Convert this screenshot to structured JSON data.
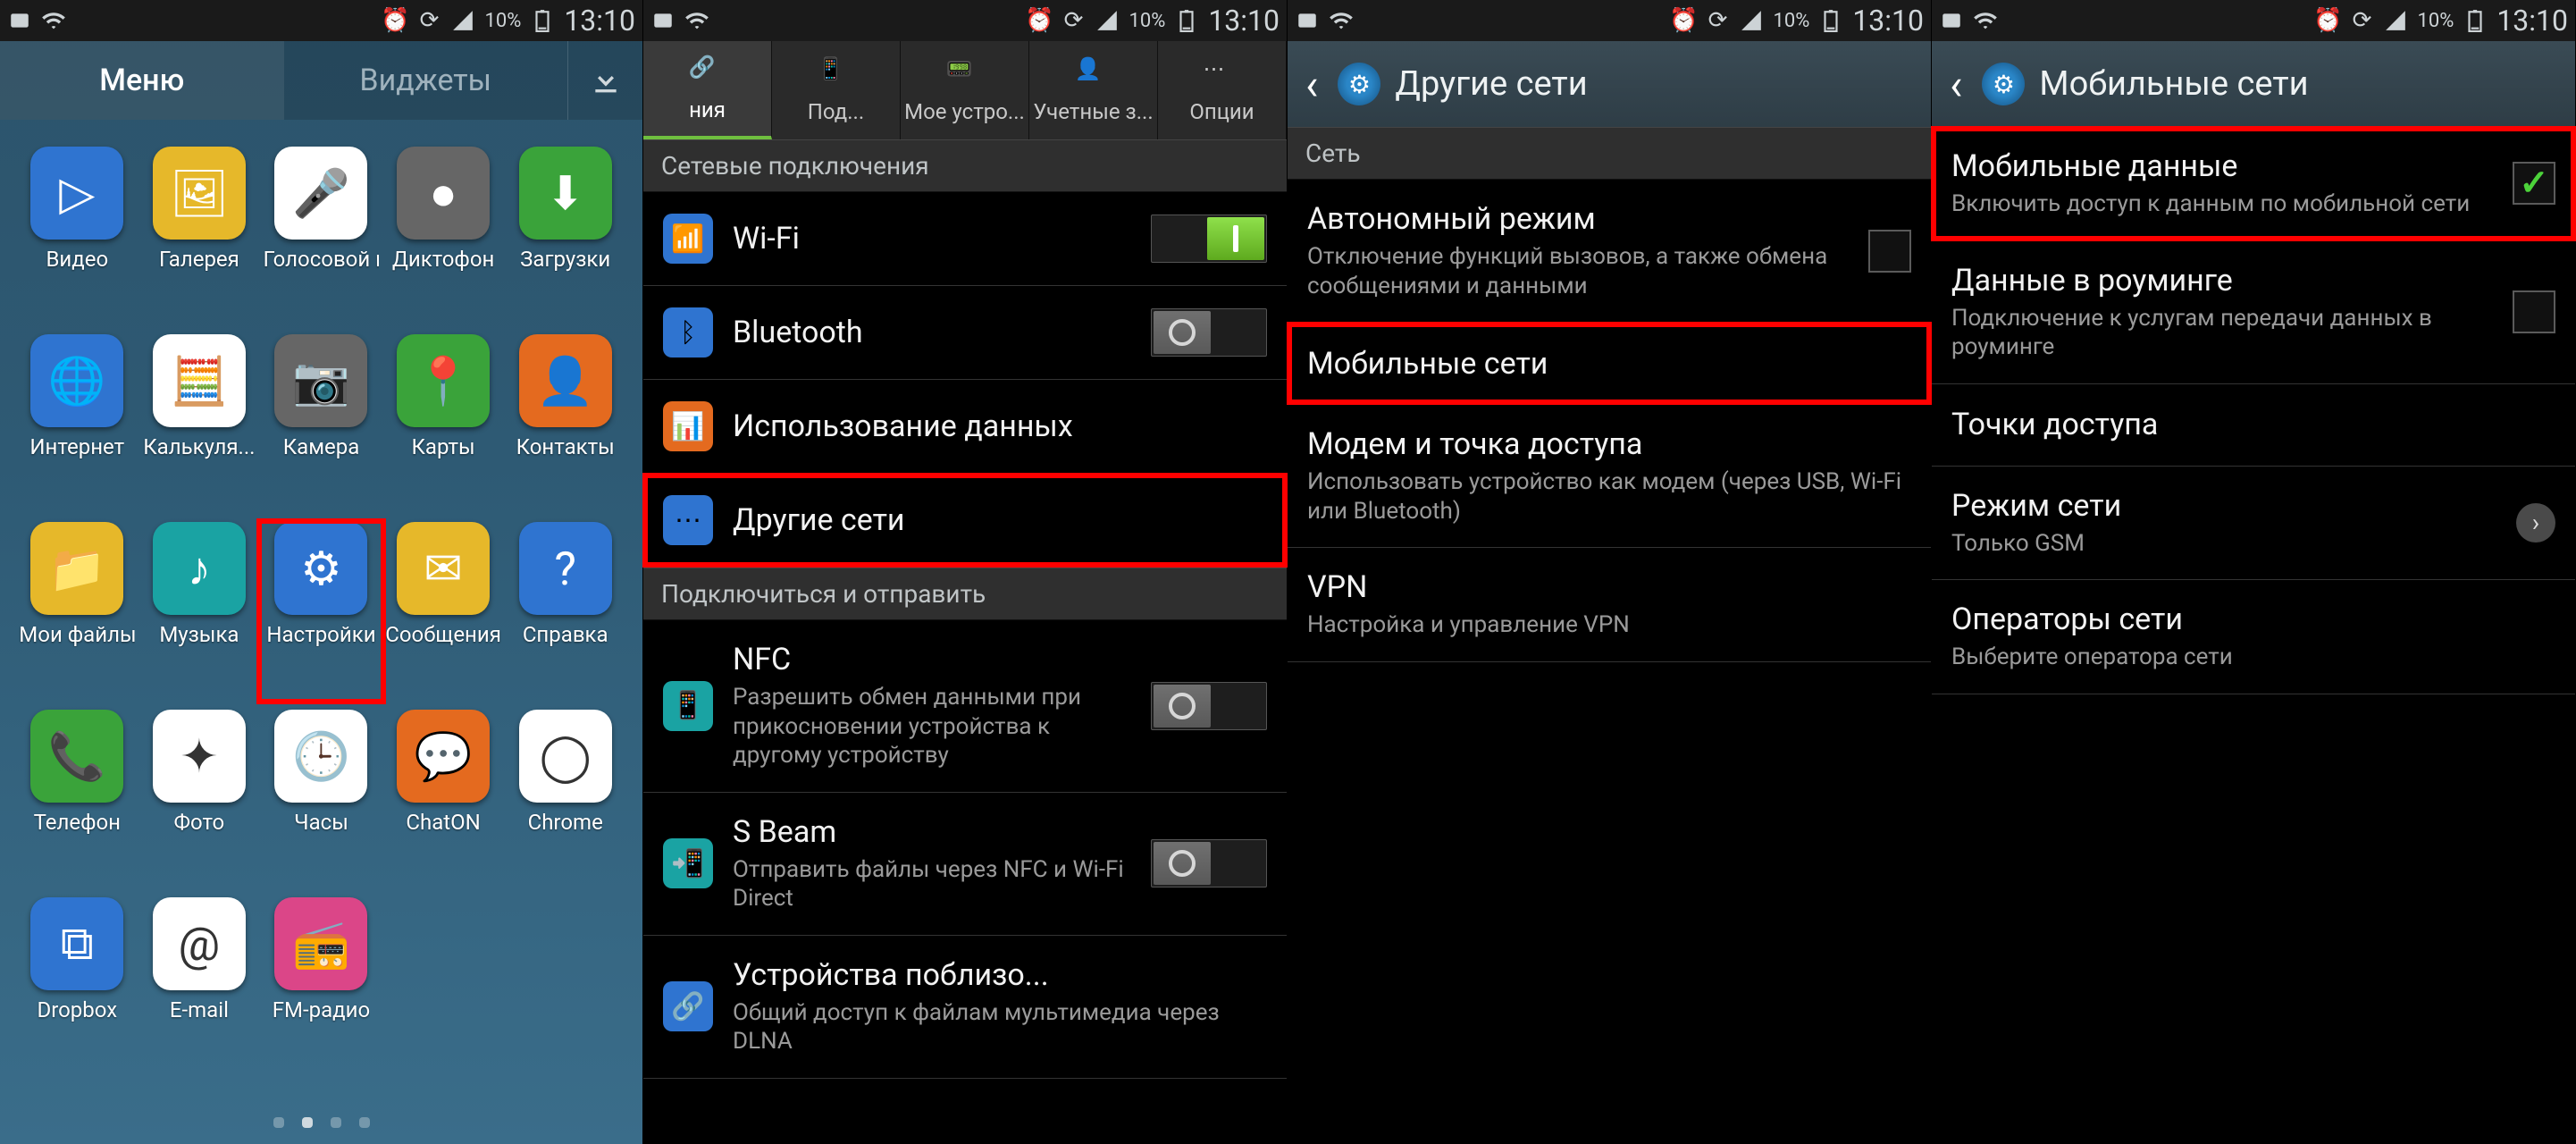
{
  "status": {
    "time": "13:10",
    "battery": "10%",
    "signal": "signal-icon",
    "wifi": "wifi-icon",
    "alarm": "alarm-icon"
  },
  "panel1": {
    "tabs": {
      "menu": "Меню",
      "widgets": "Виджеты"
    },
    "apps": [
      {
        "label": "Видео",
        "icon": "▷",
        "bg": "ic-blue"
      },
      {
        "label": "Галерея",
        "icon": "🖼",
        "bg": "ic-yellow"
      },
      {
        "label": "Голосовой поиск",
        "icon": "🎤",
        "bg": "ic-white"
      },
      {
        "label": "Диктофон",
        "icon": "●",
        "bg": "ic-grey"
      },
      {
        "label": "Загрузки",
        "icon": "⬇",
        "bg": "ic-green"
      },
      {
        "label": "Интернет",
        "icon": "🌐",
        "bg": "ic-blue"
      },
      {
        "label": "Калькуля...",
        "icon": "🧮",
        "bg": "ic-white"
      },
      {
        "label": "Камера",
        "icon": "📷",
        "bg": "ic-grey"
      },
      {
        "label": "Карты",
        "icon": "📍",
        "bg": "ic-green"
      },
      {
        "label": "Контакты",
        "icon": "👤",
        "bg": "ic-orange"
      },
      {
        "label": "Мои файлы",
        "icon": "📁",
        "bg": "ic-yellow"
      },
      {
        "label": "Музыка",
        "icon": "♪",
        "bg": "ic-teal"
      },
      {
        "label": "Настройки",
        "icon": "⚙",
        "bg": "ic-blue"
      },
      {
        "label": "Сообщения",
        "icon": "✉",
        "bg": "ic-yellow"
      },
      {
        "label": "Справка",
        "icon": "?",
        "bg": "ic-blue"
      },
      {
        "label": "Телефон",
        "icon": "📞",
        "bg": "ic-green"
      },
      {
        "label": "Фото",
        "icon": "✦",
        "bg": "ic-white"
      },
      {
        "label": "Часы",
        "icon": "🕒",
        "bg": "ic-white"
      },
      {
        "label": "ChatON",
        "icon": "💬",
        "bg": "ic-orange"
      },
      {
        "label": "Chrome",
        "icon": "◯",
        "bg": "ic-white"
      },
      {
        "label": "Dropbox",
        "icon": "⧉",
        "bg": "ic-blue"
      },
      {
        "label": "E-mail",
        "icon": "@",
        "bg": "ic-white"
      },
      {
        "label": "FM-радио",
        "icon": "📻",
        "bg": "ic-pink"
      }
    ],
    "highlight_index": 12
  },
  "panel2": {
    "tabs": [
      "ния",
      "Под...",
      "Мое устро...",
      "Учетные з...",
      "Опции"
    ],
    "active_tab_index": 0,
    "section1": "Сетевые подключения",
    "rows1": [
      {
        "title": "Wi-Fi",
        "icon": "📶",
        "bg": "ic-blue",
        "toggle": "on"
      },
      {
        "title": "Bluetooth",
        "icon": "ᛒ",
        "bg": "ic-blue",
        "toggle": "off"
      },
      {
        "title": "Использование данных",
        "icon": "📊",
        "bg": "ic-orange"
      },
      {
        "title": "Другие сети",
        "icon": "⋯",
        "bg": "ic-blue",
        "highlight": true
      }
    ],
    "section2": "Подключиться и отправить",
    "rows2": [
      {
        "title": "NFC",
        "sub": "Разрешить обмен данными при прикосновении устройства к другому устройству",
        "icon": "📱",
        "bg": "ic-teal",
        "toggle": "off"
      },
      {
        "title": "S Beam",
        "sub": "Отправить файлы через NFC и Wi-Fi Direct",
        "icon": "📲",
        "bg": "ic-teal",
        "toggle": "off"
      },
      {
        "title": "Устройства поблизо...",
        "sub": "Общий доступ к файлам мультимедиа через DLNA",
        "icon": "🔗",
        "bg": "ic-blue"
      }
    ]
  },
  "panel3": {
    "title": "Другие сети",
    "section": "Сеть",
    "rows": [
      {
        "title": "Автономный режим",
        "sub": "Отключение функций вызовов, а также обмена сообщениями и данными",
        "checkbox": false
      },
      {
        "title": "Мобильные сети",
        "highlight": true
      },
      {
        "title": "Модем и точка доступа",
        "sub": "Использовать устройство как модем (через USB, Wi-Fi или Bluetooth)"
      },
      {
        "title": "VPN",
        "sub": "Настройка и управление VPN"
      }
    ]
  },
  "panel4": {
    "title": "Мобильные сети",
    "rows": [
      {
        "title": "Мобильные данные",
        "sub": "Включить доступ к данным по мобильной сети",
        "checkbox": true,
        "highlight": true
      },
      {
        "title": "Данные в роуминге",
        "sub": "Подключение к услугам передачи данных в роуминге",
        "checkbox": false
      },
      {
        "title": "Точки доступа"
      },
      {
        "title": "Режим сети",
        "sub": "Только GSM",
        "chevron": true
      },
      {
        "title": "Операторы сети",
        "sub": "Выберите оператора сети"
      }
    ]
  }
}
